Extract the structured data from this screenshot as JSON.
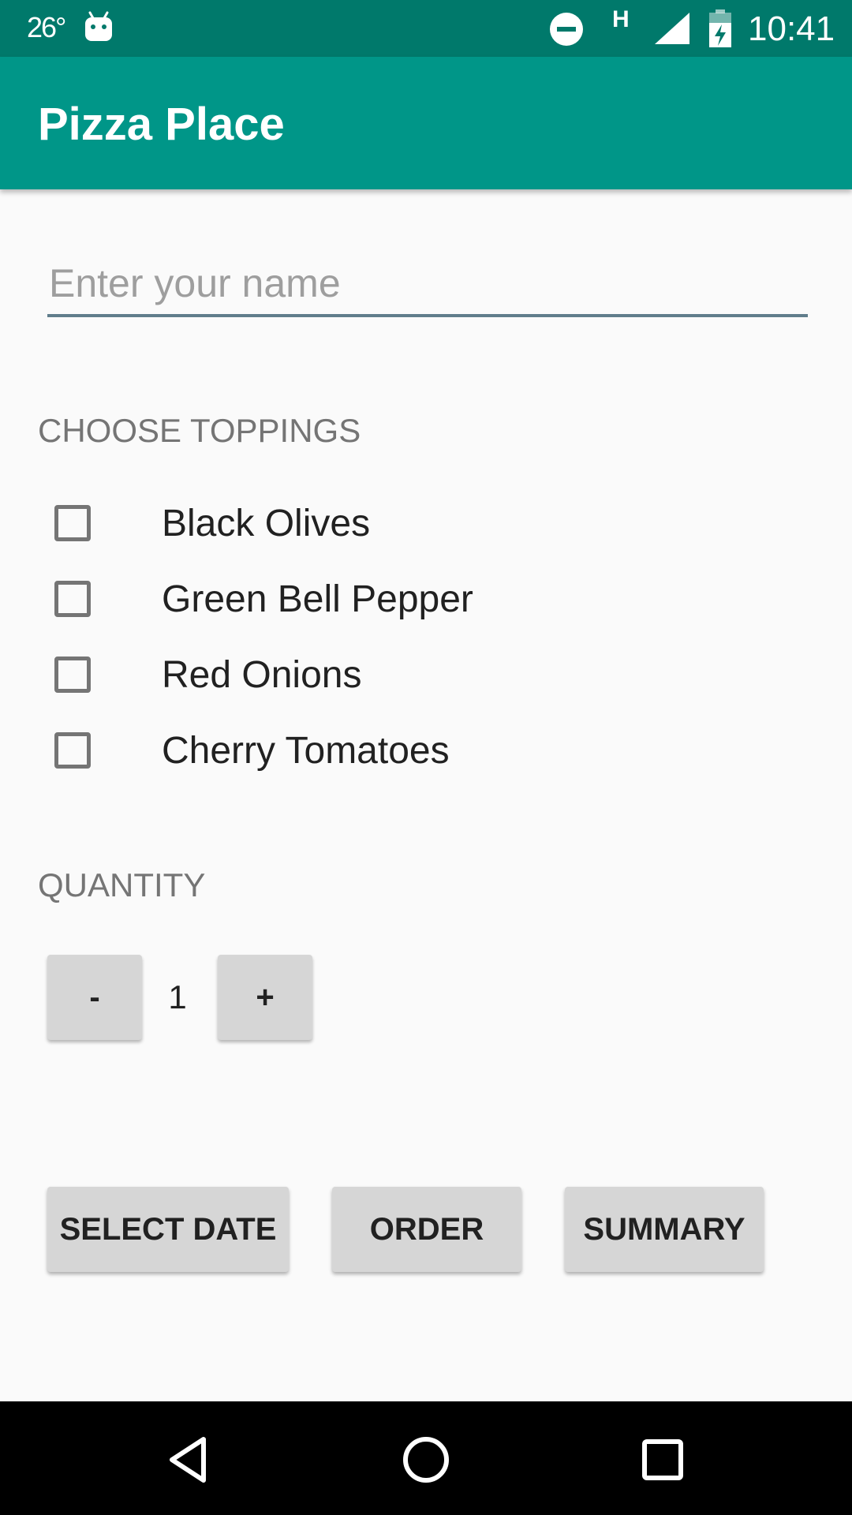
{
  "status_bar": {
    "temperature": "26°",
    "network_type": "H",
    "time": "10:41",
    "icons": [
      "android-icon",
      "do-not-disturb-icon",
      "signal-icon",
      "battery-charging-icon"
    ]
  },
  "app_bar": {
    "title": "Pizza Place",
    "color": "#009688",
    "status_color": "#00796b"
  },
  "name_input": {
    "placeholder": "Enter your name",
    "value": ""
  },
  "toppings": {
    "label": "CHOOSE TOPPINGS",
    "items": [
      {
        "label": "Black Olives",
        "checked": false
      },
      {
        "label": "Green Bell Pepper",
        "checked": false
      },
      {
        "label": "Red Onions",
        "checked": false
      },
      {
        "label": "Cherry Tomatoes",
        "checked": false
      }
    ]
  },
  "quantity": {
    "label": "QUANTITY",
    "minus_label": "-",
    "plus_label": "+",
    "value": "1"
  },
  "actions": {
    "select_date_label": "SELECT DATE",
    "order_label": "ORDER",
    "summary_label": "SUMMARY"
  },
  "nav_bar": {
    "icons": [
      "back-icon",
      "home-icon",
      "recents-icon"
    ]
  }
}
